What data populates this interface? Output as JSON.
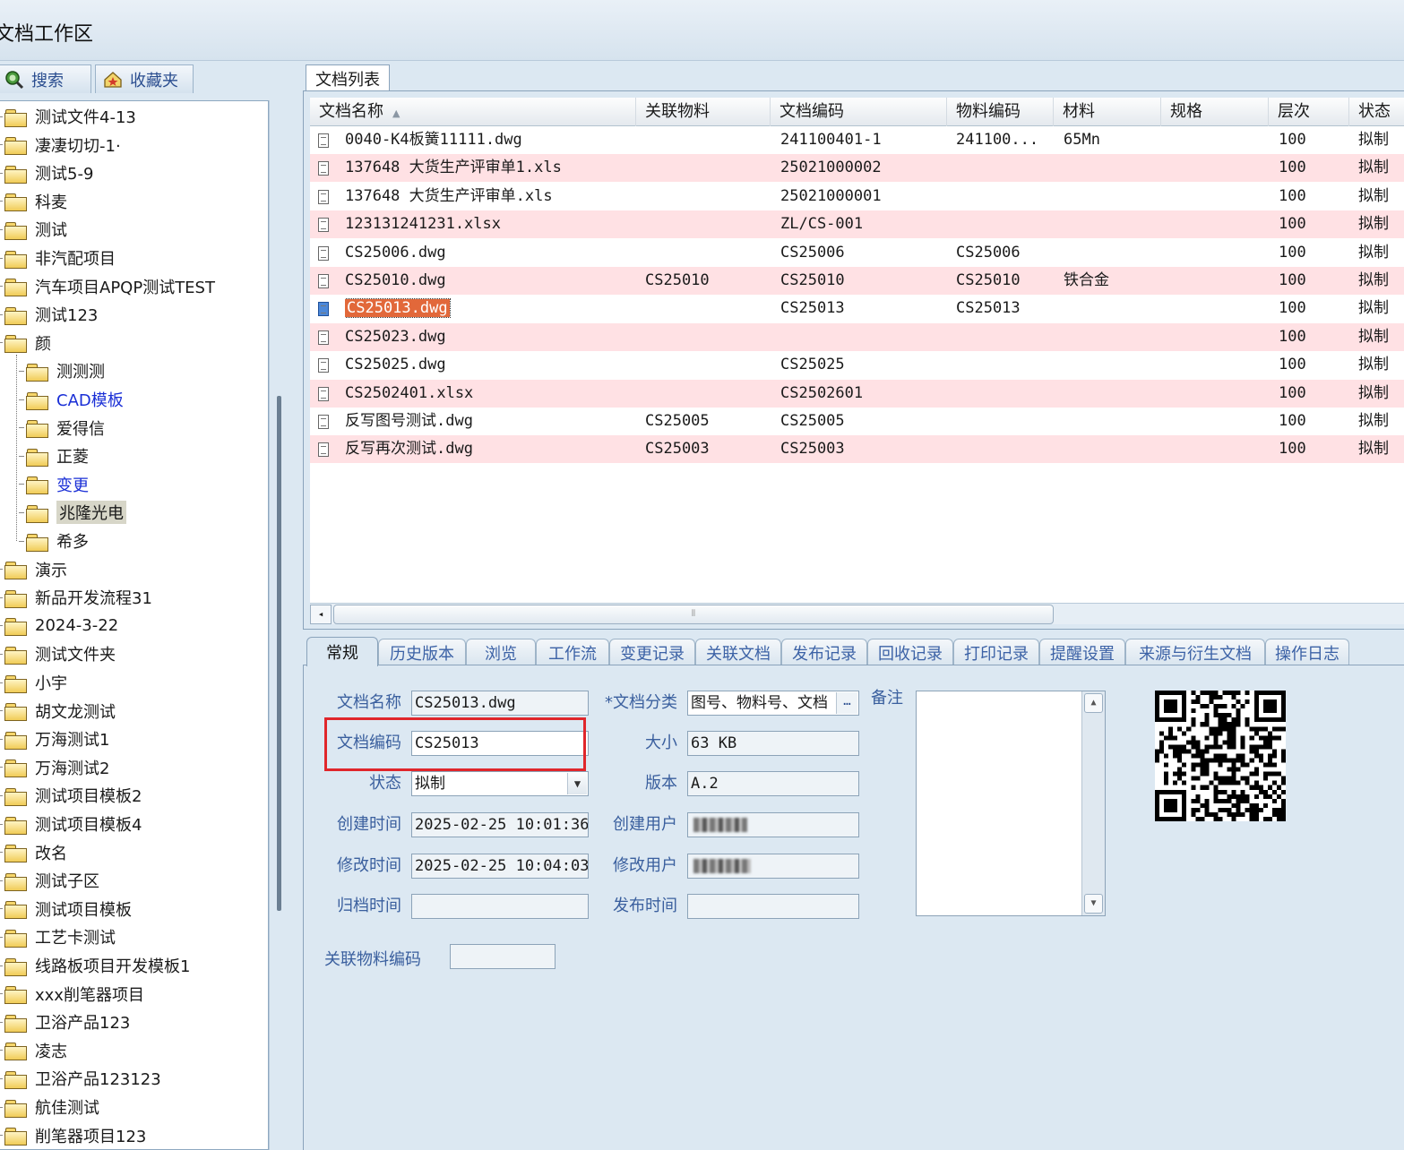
{
  "title": "文档工作区",
  "left_tabs": [
    {
      "label": "搜索"
    },
    {
      "label": "收藏夹"
    }
  ],
  "tree": {
    "top_items": [
      "测试文件4-13",
      "凄凄切切-1·",
      "测试5-9",
      "科麦",
      "测试",
      "非汽配项目",
      "汽车项目APQP测试TEST",
      "测试123",
      "颜"
    ],
    "child_items": [
      "测测测",
      "CAD模板",
      "爱得信",
      "正菱",
      "变更",
      "兆隆光电",
      "希多"
    ],
    "bottom_items": [
      "演示",
      "新品开发流程31",
      "2024-3-22",
      "测试文件夹",
      "小宇",
      "胡文龙测试",
      "万海测试1",
      "万海测试2",
      "测试项目模板2",
      "测试项目模板4",
      "改名",
      "测试子区",
      "测试项目模板",
      "工艺卡测试",
      "线路板项目开发模板1",
      "xxx削笔器项目",
      "卫浴产品123",
      "凌志",
      "卫浴产品123123",
      "航佳测试",
      "削笔器项目123"
    ]
  },
  "doc_list_tab": "文档列表",
  "columns": [
    "文档名称",
    "关联物料",
    "文档编码",
    "物料编码",
    "材料",
    "规格",
    "层次",
    "状态"
  ],
  "rows": [
    {
      "name": "0040-K4板簧11111.dwg",
      "item": "",
      "code": "241100401-1",
      "mcode": "241100...",
      "material": "65Mn",
      "spec": "",
      "level": "100",
      "status": "拟制"
    },
    {
      "name": "137648 大货生产评审单1.xls",
      "item": "",
      "code": "25021000002",
      "mcode": "",
      "material": "",
      "spec": "",
      "level": "100",
      "status": "拟制"
    },
    {
      "name": "137648 大货生产评审单.xls",
      "item": "",
      "code": "25021000001",
      "mcode": "",
      "material": "",
      "spec": "",
      "level": "100",
      "status": "拟制"
    },
    {
      "name": "123131241231.xlsx",
      "item": "",
      "code": "ZL/CS-001",
      "mcode": "",
      "material": "",
      "spec": "",
      "level": "100",
      "status": "拟制"
    },
    {
      "name": "CS25006.dwg",
      "item": "",
      "code": "CS25006",
      "mcode": "CS25006",
      "material": "",
      "spec": "",
      "level": "100",
      "status": "拟制"
    },
    {
      "name": "CS25010.dwg",
      "item": "CS25010",
      "code": "CS25010",
      "mcode": "CS25010",
      "material": "铁合金",
      "spec": "",
      "level": "100",
      "status": "拟制"
    },
    {
      "name": "CS25013.dwg",
      "item": "",
      "code": "CS25013",
      "mcode": "CS25013",
      "material": "",
      "spec": "",
      "level": "100",
      "status": "拟制"
    },
    {
      "name": "CS25023.dwg",
      "item": "",
      "code": "",
      "mcode": "",
      "material": "",
      "spec": "",
      "level": "100",
      "status": "拟制"
    },
    {
      "name": "CS25025.dwg",
      "item": "",
      "code": "CS25025",
      "mcode": "",
      "material": "",
      "spec": "",
      "level": "100",
      "status": "拟制"
    },
    {
      "name": "CS2502401.xlsx",
      "item": "",
      "code": "CS2502601",
      "mcode": "",
      "material": "",
      "spec": "",
      "level": "100",
      "status": "拟制"
    },
    {
      "name": "反写图号测试.dwg",
      "item": "CS25005",
      "code": "CS25005",
      "mcode": "",
      "material": "",
      "spec": "",
      "level": "100",
      "status": "拟制"
    },
    {
      "name": "反写再次测试.dwg",
      "item": "CS25003",
      "code": "CS25003",
      "mcode": "",
      "material": "",
      "spec": "",
      "level": "100",
      "status": "拟制"
    }
  ],
  "detail_tabs": [
    "常规",
    "历史版本",
    "浏览",
    "工作流",
    "变更记录",
    "关联文档",
    "发布记录",
    "回收记录",
    "打印记录",
    "提醒设置",
    "来源与衍生文档",
    "操作日志"
  ],
  "form": {
    "doc_name_label": "文档名称",
    "doc_name": "CS25013.dwg",
    "doc_code_label": "文档编码",
    "doc_code": "CS25013",
    "status_label": "状态",
    "status": "拟制",
    "created_time_label": "创建时间",
    "created_time": "2025-02-25 10:01:36",
    "modified_time_label": "修改时间",
    "modified_time": "2025-02-25 10:04:03",
    "archive_time_label": "归档时间",
    "archive_time": "",
    "category_label": "*文档分类",
    "category": "图号、物料号、文档",
    "size_label": "大小",
    "size": "63 KB",
    "version_label": "版本",
    "version": "A.2",
    "created_user_label": "创建用户",
    "modified_user_label": "修改用户",
    "publish_time_label": "发布时间",
    "publish_time": "",
    "note_label": "备注",
    "related_item_code_label": "关联物料编码",
    "related_item_code": ""
  },
  "selected_row": 6,
  "colors": {
    "accent_red": "#e0262b",
    "row_pink": "#ffe1e4",
    "selection": "#e2683a"
  }
}
